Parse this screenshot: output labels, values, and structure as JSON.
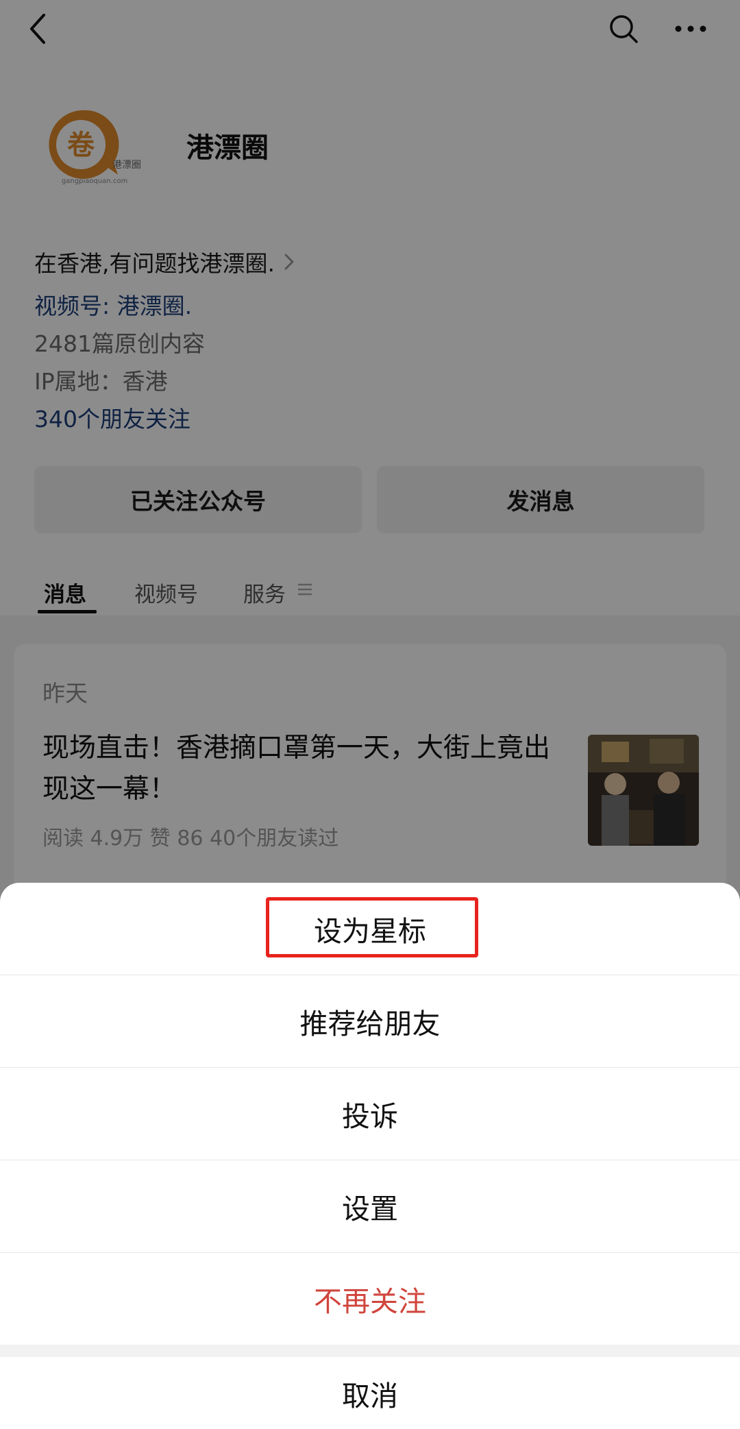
{
  "account": {
    "name": "港漂圈",
    "logo_text": "港漂圈",
    "logo_url_text": "gangpiaoquan.com",
    "bio": "在香港,有问题找港漂圈.",
    "channel": "视频号: 港漂圈.",
    "original_count": "2481篇原创内容",
    "ip_location": "IP属地：香港",
    "friends_following": "340个朋友关注"
  },
  "header": {
    "icons": [
      "back-icon",
      "search-icon",
      "more-icon"
    ]
  },
  "actions": {
    "follow_label": "已关注公众号",
    "message_label": "发消息"
  },
  "tabs": [
    {
      "label": "消息"
    },
    {
      "label": "视频号"
    },
    {
      "label": "服务"
    }
  ],
  "feed": {
    "date": "昨天",
    "title": "现场直击！香港摘口罩第一天，大街上竟出现这一幕！",
    "meta": "阅读 4.9万  赞 86  40个朋友读过"
  },
  "sheet": {
    "items": [
      {
        "label": "设为星标"
      },
      {
        "label": "推荐给朋友"
      },
      {
        "label": "投诉"
      },
      {
        "label": "设置"
      },
      {
        "label": "不再关注"
      }
    ],
    "cancel_label": "取消"
  },
  "colors": {
    "link": "#1d3f7a",
    "danger": "#d0453c",
    "highlight": "#e8231d",
    "logo": "#e08a2c"
  }
}
